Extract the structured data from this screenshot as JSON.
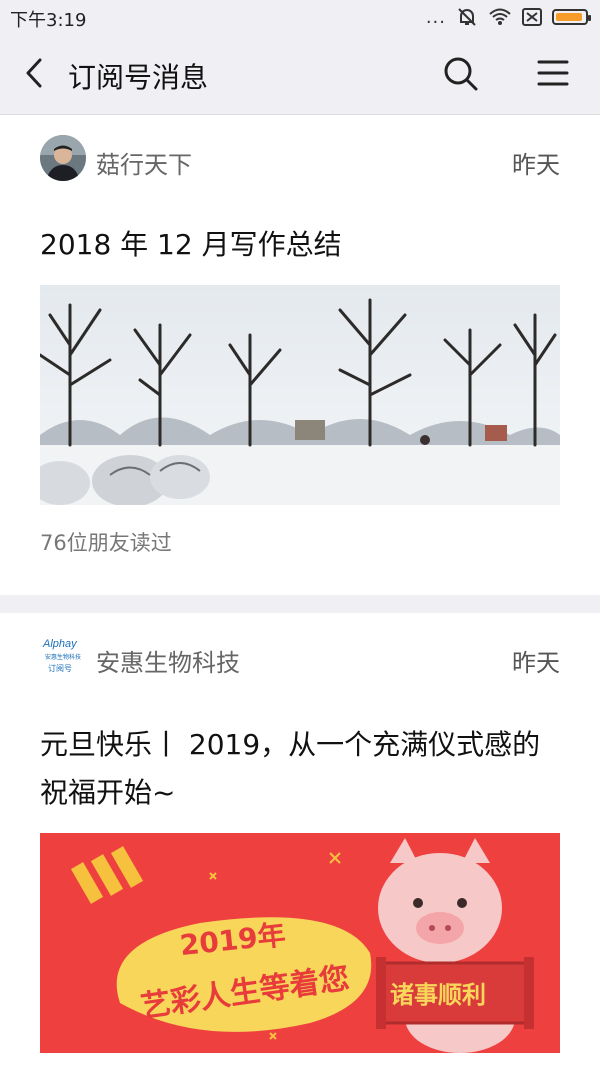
{
  "status": {
    "time": "下午3:19",
    "dots": "...",
    "battery_color": "#f79b2a"
  },
  "nav": {
    "title": "订阅号消息",
    "back_icon": "chevron-left-icon",
    "search_icon": "search-icon",
    "menu_icon": "hamburger-menu-icon"
  },
  "posts": [
    {
      "author": "菇行天下",
      "time": "昨天",
      "title": "2018 年 12 月写作总结",
      "readers": "76位朋友读过",
      "image": "snowy-park-image"
    },
    {
      "author": "安惠生物科技",
      "time": "昨天",
      "title_line1": "元旦快乐丨 2019，从一个充满仪式感的",
      "title_line2": "祝福开始~",
      "logo_text": "Alphay",
      "logo_sub": "安惠生物科技",
      "logo_sub2": "订阅号",
      "banner_year": "2019年",
      "banner_slogan": "艺彩人生等着您",
      "banner_scroll": "诸事顺利",
      "image": "new-year-pig-banner"
    }
  ]
}
